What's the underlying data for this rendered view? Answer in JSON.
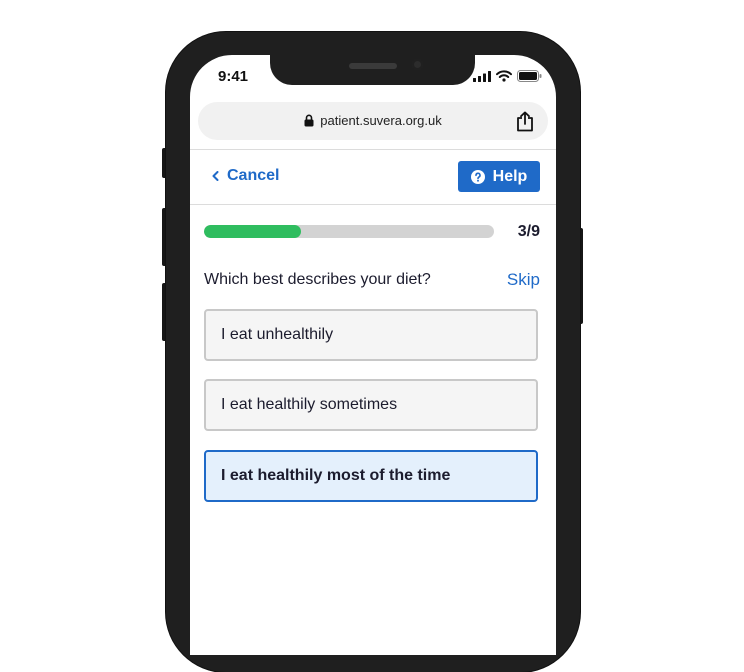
{
  "status_bar": {
    "time": "9:41"
  },
  "browser": {
    "url": "patient.suvera.org.uk"
  },
  "nav": {
    "cancel_label": "Cancel",
    "help_label": "Help"
  },
  "progress": {
    "current": 3,
    "total": 9,
    "label": "3/9",
    "fraction": 0.333
  },
  "question": {
    "text": "Which best describes your diet?",
    "skip_label": "Skip"
  },
  "options": [
    {
      "label": "I eat unhealthily",
      "selected": false
    },
    {
      "label": "I eat healthily sometimes",
      "selected": false
    },
    {
      "label": "I eat healthily most of the time",
      "selected": true
    }
  ],
  "colors": {
    "accent": "#1f6ac8",
    "progress": "#2fbd5f",
    "selected_bg": "#e4f0fc"
  }
}
